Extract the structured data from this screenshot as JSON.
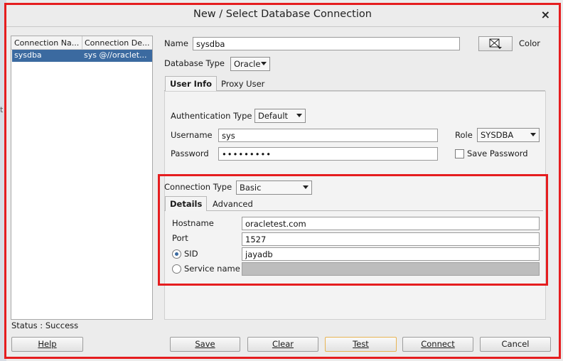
{
  "window": {
    "title": "New / Select Database Connection"
  },
  "connection_list": {
    "headers": [
      "Connection Na...",
      "Connection De..."
    ],
    "rows": [
      {
        "name": "sysdba",
        "details": "sys @//oraclet..."
      }
    ]
  },
  "form": {
    "name_label": "Name",
    "name_value": "sysdba",
    "color_label": "Color",
    "db_type_label": "Database Type",
    "db_type_value": "Oracle",
    "tabs": [
      "User Info",
      "Proxy User"
    ],
    "auth_type_label": "Authentication Type",
    "auth_type_value": "Default",
    "username_label": "Username",
    "username_value": "sys",
    "role_label": "Role",
    "role_value": "SYSDBA",
    "password_label": "Password",
    "password_value": "•••••••••",
    "save_password_label": "Save Password",
    "conn_type_label": "Connection Type",
    "conn_type_value": "Basic",
    "detail_tabs": [
      "Details",
      "Advanced"
    ],
    "hostname_label": "Hostname",
    "hostname_value": "oracletest.com",
    "port_label": "Port",
    "port_value": "1527",
    "sid_label": "SID",
    "sid_value": "jayadb",
    "service_label": "Service name",
    "service_value": ""
  },
  "status": {
    "text": "Status : Success"
  },
  "buttons": {
    "help": "Help",
    "save": "Save",
    "clear": "Clear",
    "test": "Test",
    "connect": "Connect",
    "cancel": "Cancel"
  }
}
